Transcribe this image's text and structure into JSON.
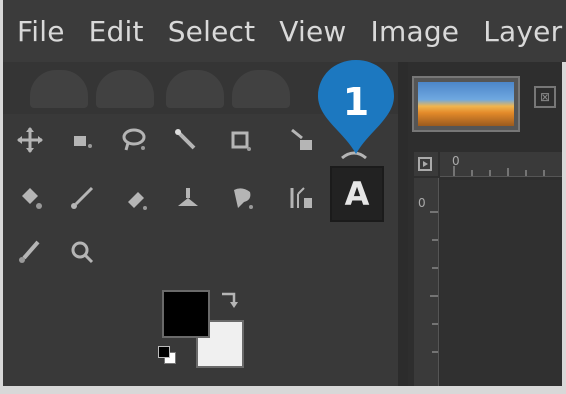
{
  "menubar": {
    "items": [
      "File",
      "Edit",
      "Select",
      "View",
      "Image",
      "Layer"
    ]
  },
  "toolbox": {
    "tools": [
      {
        "icon": "move-icon"
      },
      {
        "icon": "align-icon"
      },
      {
        "icon": "free-select-icon"
      },
      {
        "icon": "fuzzy-select-icon"
      },
      {
        "icon": "crop-icon"
      },
      {
        "icon": "unified-transform-icon"
      },
      {
        "icon": "warp-icon"
      },
      {
        "icon": "bucket-fill-icon"
      },
      {
        "icon": "paintbrush-icon"
      },
      {
        "icon": "eraser-icon"
      },
      {
        "icon": "clone-icon"
      },
      {
        "icon": "smudge-icon"
      },
      {
        "icon": "paths-icon"
      },
      {
        "icon": "text-tool-icon",
        "glyph": "A",
        "selected": true
      },
      {
        "icon": "color-picker-icon"
      },
      {
        "icon": "zoom-icon"
      }
    ],
    "colors": {
      "foreground": "#000000",
      "background": "#ffffff"
    }
  },
  "image_tabs": {
    "close_glyph": "⊠"
  },
  "ruler": {
    "top_label": "0",
    "left_label": "0"
  },
  "callout": {
    "number": "1",
    "color": "#1c78c0"
  }
}
